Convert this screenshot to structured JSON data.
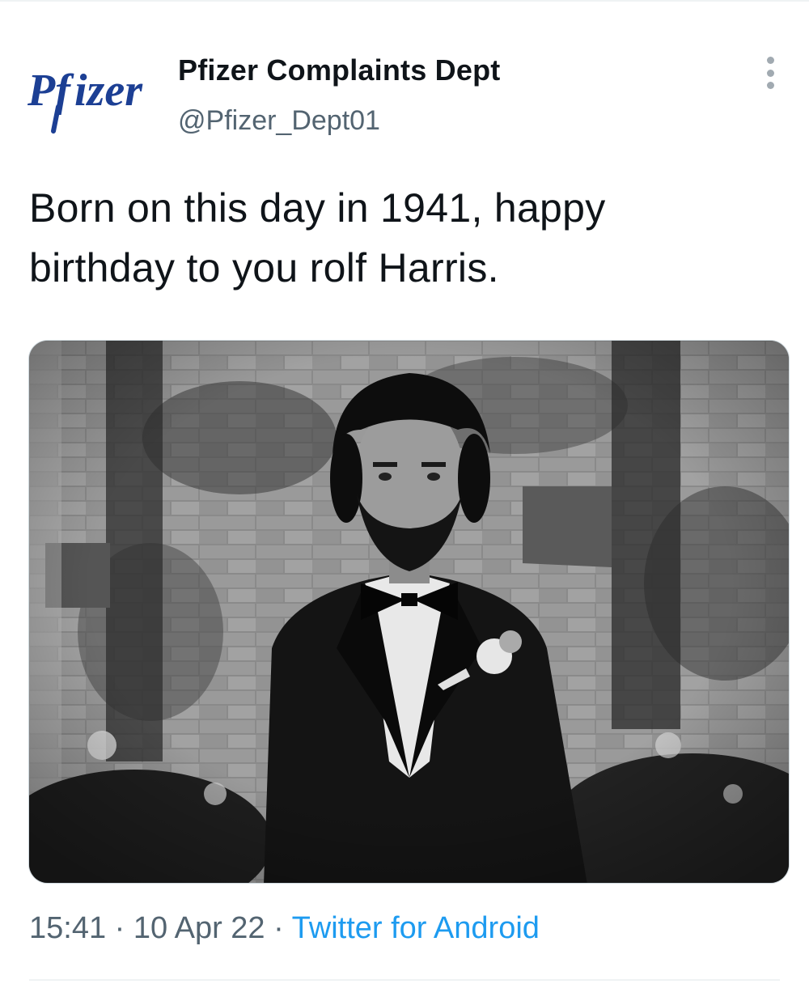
{
  "account": {
    "display_name": "Pfizer Complaints Dept",
    "handle": "@Pfizer_Dept01",
    "avatar_logo_text": "Pfizer",
    "avatar_logo_color": "#1c3f94"
  },
  "tweet": {
    "text_line_1": "Born on this day in 1941, happy",
    "text_line_2": "birthday to you rolf Harris."
  },
  "media": {
    "kind": "black-and-white photo"
  },
  "meta": {
    "time": "15:41",
    "separator_1": " · ",
    "date": "10 Apr 22",
    "separator_2": " · ",
    "source": "Twitter for Android"
  },
  "icons": {
    "more": "more-vertical-icon"
  },
  "colors": {
    "text_primary": "#0f1419",
    "text_secondary": "#536471",
    "link": "#1d9bf0"
  }
}
